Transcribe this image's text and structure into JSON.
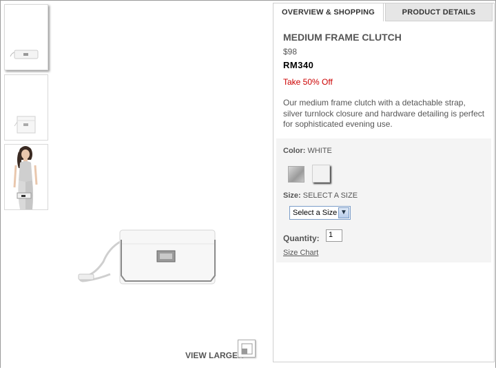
{
  "tabs": [
    {
      "label": "OVERVIEW & SHOPPING"
    },
    {
      "label": "PRODUCT DETAILS"
    }
  ],
  "product": {
    "title": "MEDIUM FRAME CLUTCH",
    "price_usd": "$98",
    "price_rm": "RM340",
    "promo": "Take 50% Off",
    "description": "Our medium frame clutch with a detachable strap, silver turnlock closure and hardware detailing is perfect for sophisticated evening use."
  },
  "options": {
    "color_label": "Color:",
    "color_value": "WHITE",
    "size_label": "Size:",
    "size_value": "SELECT A SIZE",
    "size_select": "Select a Size",
    "quantity_label": "Quantity:",
    "quantity_value": "1",
    "size_chart": "Size Chart"
  },
  "gallery": {
    "view_larger": "VIEW LARGER"
  },
  "colors": {
    "promo": "#cc0000",
    "tab_inactive_bg": "#e6e6e6",
    "options_bg": "#f4f4f4"
  }
}
